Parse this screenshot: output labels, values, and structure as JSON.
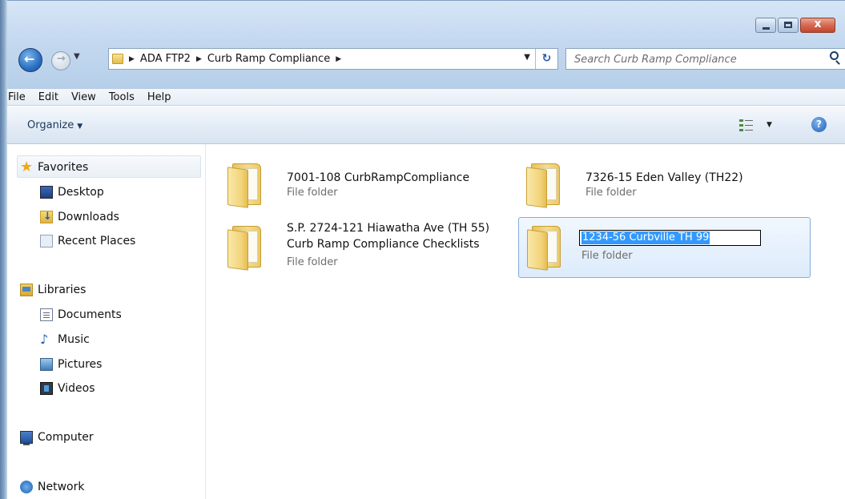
{
  "window": {
    "buttons": {
      "minimize": "–",
      "maximize": "□",
      "close": "x"
    }
  },
  "address": {
    "crumbs": [
      "ADA FTP2",
      "Curb Ramp Compliance"
    ]
  },
  "search": {
    "placeholder": "Search Curb Ramp Compliance"
  },
  "menu": [
    "File",
    "Edit",
    "View",
    "Tools",
    "Help"
  ],
  "toolbar": {
    "organize_label": "Organize",
    "help_label": "?"
  },
  "nav": {
    "favorites": "Favorites",
    "desktop": "Desktop",
    "downloads": "Downloads",
    "recent": "Recent Places",
    "libraries": "Libraries",
    "documents": "Documents",
    "music": "Music",
    "pictures": "Pictures",
    "videos": "Videos",
    "computer": "Computer",
    "network": "Network"
  },
  "items": [
    {
      "name": "7001-108 CurbRampCompliance",
      "type": "File folder"
    },
    {
      "name": "7326-15 Eden Valley (TH22)",
      "type": "File folder"
    },
    {
      "name_line1": "S.P. 2724-121 Hiawatha Ave (TH 55)",
      "name_line2": "Curb Ramp Compliance Checklists",
      "type": "File folder"
    },
    {
      "rename_value": "1234-56 Curbville TH 99",
      "type": "File folder"
    }
  ],
  "icons": {
    "back": "back-arrow-icon",
    "forward": "forward-arrow-icon",
    "refresh": "refresh-icon",
    "search": "search-icon",
    "help": "help-icon",
    "views": "views-icon",
    "folder": "folder-icon"
  }
}
